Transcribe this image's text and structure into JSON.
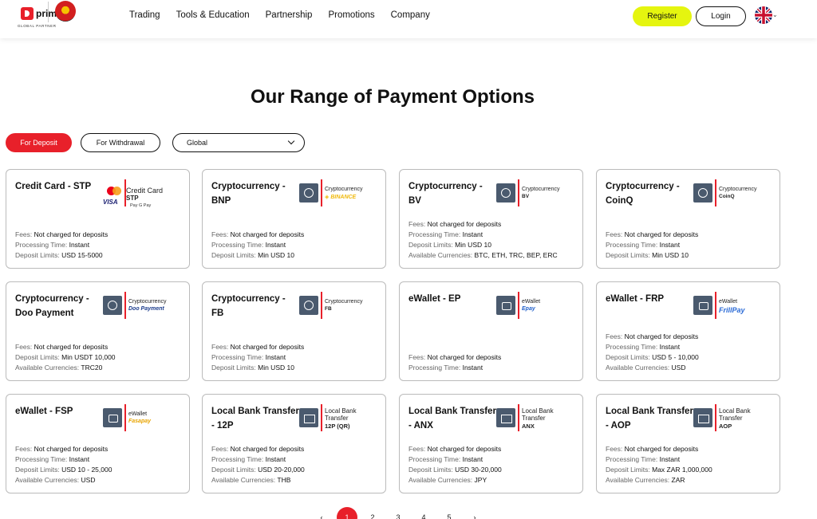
{
  "header": {
    "logo_text": "prime",
    "logo_sub": "GLOBAL PARTNER",
    "nav": [
      "Trading",
      "Tools & Education",
      "Partnership",
      "Promotions",
      "Company"
    ],
    "register_label": "Register",
    "login_label": "Login"
  },
  "page_title": "Our Range of Payment Options",
  "filters": {
    "deposit_label": "For Deposit",
    "withdraw_label": "For Withdrawal",
    "region_value": "Global"
  },
  "cards": [
    {
      "title": "Credit Card - STP",
      "logo_top": "Credit Card",
      "logo_sub": "STP",
      "logo_brand": "",
      "pay_row": "Pay  G Pay",
      "rows": [
        {
          "label": "Fees:",
          "value": "Not charged for deposits"
        },
        {
          "label": "Processing Time:",
          "value": "Instant"
        },
        {
          "label": "Deposit Limits:",
          "value": "USD 15-5000"
        }
      ]
    },
    {
      "title": "Cryptocurrency - BNP",
      "logo_top": "Cryptocurrency",
      "logo_sub": "",
      "logo_brand": "◈ BINANCE",
      "rows": [
        {
          "label": "Fees:",
          "value": "Not charged for deposits"
        },
        {
          "label": "Processing Time:",
          "value": "Instant"
        },
        {
          "label": "Deposit Limits:",
          "value": "Min USD 10"
        }
      ]
    },
    {
      "title": "Cryptocurrency - BV",
      "logo_top": "Cryptocurrency",
      "logo_sub": "BV",
      "logo_brand": "",
      "rows": [
        {
          "label": "Fees:",
          "value": "Not charged for deposits"
        },
        {
          "label": "Processing Time:",
          "value": "Instant"
        },
        {
          "label": "Deposit Limits:",
          "value": "Min USD 10"
        },
        {
          "label": "Available Currencies:",
          "value": "BTC, ETH, TRC, BEP, ERC"
        }
      ]
    },
    {
      "title": "Cryptocurrency - CoinQ",
      "logo_top": "Cryptocurrency",
      "logo_sub": "CoinQ",
      "logo_brand": "",
      "rows": [
        {
          "label": "Fees:",
          "value": "Not charged for deposits"
        },
        {
          "label": "Processing Time:",
          "value": "Instant"
        },
        {
          "label": "Deposit Limits:",
          "value": "Min USD 10"
        }
      ]
    },
    {
      "title": "Cryptocurrency - Doo Payment",
      "logo_top": "Cryptocurrency",
      "logo_sub": "",
      "logo_brand": "Doo Payment",
      "rows": [
        {
          "label": "Fees:",
          "value": "Not charged for deposits"
        },
        {
          "label": "Deposit Limits:",
          "value": "Min USDT 10,000"
        },
        {
          "label": "Available Currencies:",
          "value": "TRC20"
        }
      ]
    },
    {
      "title": "Cryptocurrency - FB",
      "logo_top": "Cryptocurrency",
      "logo_sub": "FB",
      "logo_brand": "",
      "rows": [
        {
          "label": "Fees:",
          "value": "Not charged for deposits"
        },
        {
          "label": "Processing Time:",
          "value": "Instant"
        },
        {
          "label": "Deposit Limits:",
          "value": "Min USD 10"
        }
      ]
    },
    {
      "title": "eWallet - EP",
      "logo_top": "eWallet",
      "logo_sub": "",
      "logo_brand": "Epay",
      "rows": [
        {
          "label": "Fees:",
          "value": "Not charged for deposits"
        },
        {
          "label": "Processing Time:",
          "value": "Instant"
        }
      ]
    },
    {
      "title": "eWallet - FRP",
      "logo_top": "eWallet",
      "logo_sub": "",
      "logo_brand": "FrillPay",
      "rows": [
        {
          "label": "Fees:",
          "value": "Not charged for deposits"
        },
        {
          "label": "Processing Time:",
          "value": "Instant"
        },
        {
          "label": "Deposit Limits:",
          "value": "USD 5 - 10,000"
        },
        {
          "label": "Available Currencies:",
          "value": "USD"
        }
      ]
    },
    {
      "title": "eWallet - FSP",
      "logo_top": "eWallet",
      "logo_sub": "",
      "logo_brand": "Fasapay",
      "rows": [
        {
          "label": "Fees:",
          "value": "Not charged for deposits"
        },
        {
          "label": "Processing Time:",
          "value": "Instant"
        },
        {
          "label": "Deposit Limits:",
          "value": "USD 10 - 25,000"
        },
        {
          "label": "Available Currencies:",
          "value": "USD"
        }
      ]
    },
    {
      "title": "Local Bank Transfer - 12P",
      "logo_top": "Local Bank Transfer",
      "logo_sub": "12P (QR)",
      "logo_brand": "",
      "rows": [
        {
          "label": "Fees:",
          "value": "Not charged for deposits"
        },
        {
          "label": "Processing Time:",
          "value": "Instant"
        },
        {
          "label": "Deposit Limits:",
          "value": "USD 20-20,000"
        },
        {
          "label": "Available Currencies:",
          "value": "THB"
        }
      ]
    },
    {
      "title": "Local Bank Transfer - ANX",
      "logo_top": "Local Bank Transfer",
      "logo_sub": "ANX",
      "logo_brand": "",
      "rows": [
        {
          "label": "Fees:",
          "value": "Not charged for deposits"
        },
        {
          "label": "Processing Time:",
          "value": "Instant"
        },
        {
          "label": "Deposit Limits:",
          "value": "USD 30-20,000"
        },
        {
          "label": "Available Currencies:",
          "value": "JPY"
        }
      ]
    },
    {
      "title": "Local Bank Transfer - AOP",
      "logo_top": "Local Bank Transfer",
      "logo_sub": "AOP",
      "logo_brand": "",
      "rows": [
        {
          "label": "Fees:",
          "value": "Not charged for deposits"
        },
        {
          "label": "Processing Time:",
          "value": "Instant"
        },
        {
          "label": "Deposit Limits:",
          "value": "Max ZAR 1,000,000"
        },
        {
          "label": "Available Currencies:",
          "value": "ZAR"
        }
      ]
    }
  ],
  "pagination": {
    "prev": "‹",
    "pages": [
      "1",
      "2",
      "3",
      "4",
      "5"
    ],
    "next": "›",
    "active": "1"
  },
  "colors": {
    "accent": "#e8202a",
    "register": "#e5f50f"
  }
}
